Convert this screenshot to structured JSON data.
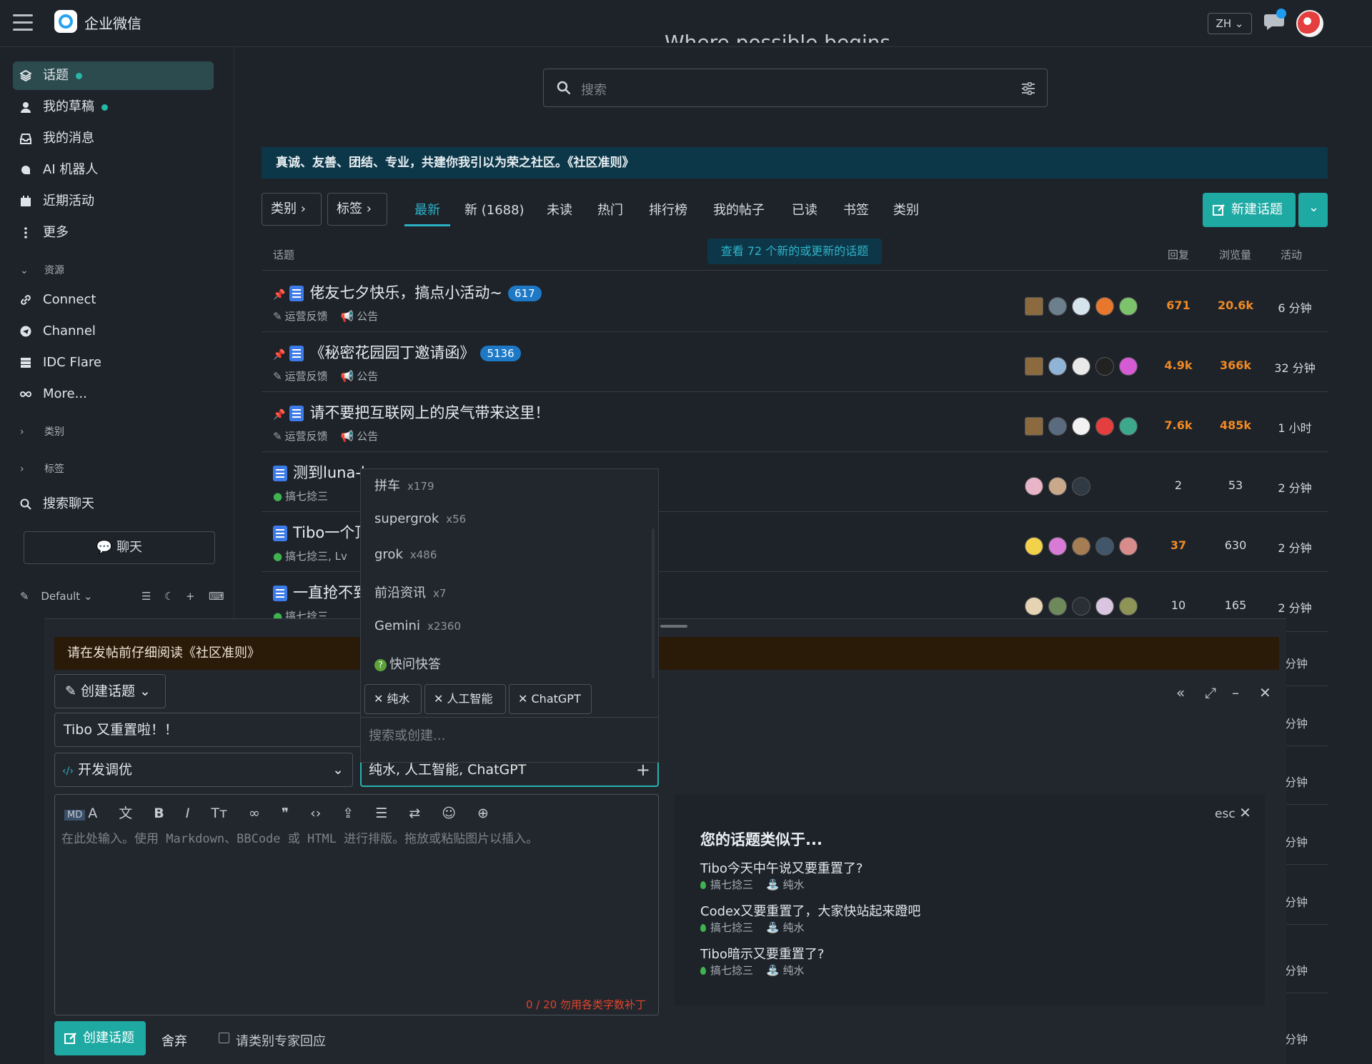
{
  "header": {
    "app_title": "企业微信",
    "lang": "ZH"
  },
  "sidebar": {
    "items": [
      {
        "label": "话题"
      },
      {
        "label": "我的草稿"
      },
      {
        "label": "我的消息"
      },
      {
        "label": "AI 机器人"
      },
      {
        "label": "近期活动"
      },
      {
        "label": "更多"
      }
    ],
    "resources_label": "资源",
    "resources": [
      {
        "label": "Connect"
      },
      {
        "label": "Channel"
      },
      {
        "label": "IDC Flare"
      },
      {
        "label": "More..."
      }
    ],
    "categories_label": "类别",
    "tags_label": "标签",
    "search_chat": "搜索聊天",
    "chat_button": "聊天",
    "theme_label": "Default"
  },
  "main": {
    "partial_heading": "Where possible begins",
    "search_placeholder": "搜索",
    "banner": "真诚、友善、团结、专业，共建你我引以为荣之社区。《社区准则》",
    "filters": {
      "category": "类别",
      "tag": "标签"
    },
    "tabs": [
      {
        "label": "最新"
      },
      {
        "label": "新 (1688)"
      },
      {
        "label": "未读"
      },
      {
        "label": "热门"
      },
      {
        "label": "排行榜"
      },
      {
        "label": "我的帖子"
      },
      {
        "label": "已读"
      },
      {
        "label": "书签"
      },
      {
        "label": "类别"
      }
    ],
    "new_topic": "新建话题",
    "columns": {
      "topic": "话题",
      "replies": "回复",
      "views": "浏览量",
      "activity": "活动"
    },
    "new_topics_notice": "查看 72 个新的或更新的话题",
    "topics": [
      {
        "title": "佬友七夕快乐，搞点小活动~",
        "badge": "617",
        "category": "运营反馈",
        "tag": "公告",
        "replies": "671",
        "views": "20.6k",
        "activity": "6 分钟"
      },
      {
        "title": "《秘密花园园丁邀请函》",
        "badge": "5136",
        "category": "运营反馈",
        "tag": "公告",
        "replies": "4.9k",
        "views": "366k",
        "activity": "32 分钟"
      },
      {
        "title": "请不要把互联网上的戾气带来这里！",
        "badge": "",
        "category": "运营反馈",
        "tag": "公告",
        "replies": "7.6k",
        "views": "485k",
        "activity": "1 小时"
      },
      {
        "title": "测到luna-l",
        "badge": "",
        "category": "搞七捻三",
        "tag": "",
        "replies": "2",
        "views": "53",
        "activity": "2 分钟"
      },
      {
        "title": "Tibo一个顶",
        "badge": "",
        "category": "搞七捻三, Lv",
        "tag": "",
        "replies": "37",
        "views": "630",
        "activity": "2 分钟"
      },
      {
        "title": "一直抢不到",
        "badge": "",
        "category": "搞七捻三",
        "tag": "",
        "replies": "10",
        "views": "165",
        "activity": "2 分钟"
      }
    ],
    "right_activity": [
      "分钟",
      "分钟",
      "分钟",
      "分钟",
      "分钟",
      "分钟",
      "分钟"
    ]
  },
  "composer": {
    "notice": "请在发帖前仔细阅读《社区准则》",
    "action": "创建话题",
    "title_value": "Tibo 又重置啦！！",
    "category_value": "开发调优",
    "tags_value": "纯水, 人工智能, ChatGPT",
    "editor_placeholder": "在此处输入。使用 Markdown、BBCode 或 HTML 进行排版。拖放或粘贴图片以插入。",
    "count_hint": "0 / 20 勿用各类字数补丁",
    "create_button": "创建话题",
    "discard": "舍弃",
    "expert_checkbox": "请类别专家回应"
  },
  "tag_dropdown": {
    "options": [
      {
        "name": "拼车",
        "count": "x179"
      },
      {
        "name": "supergrok",
        "count": "x56"
      },
      {
        "name": "grok",
        "count": "x486"
      },
      {
        "name": "前沿资讯",
        "count": "x7"
      },
      {
        "name": "Gemini",
        "count": "x2360"
      },
      {
        "name": "快问快答",
        "count": ""
      }
    ],
    "selected": [
      "纯水",
      "人工智能",
      "ChatGPT"
    ],
    "search_placeholder": "搜索或创建..."
  },
  "similar": {
    "esc": "esc",
    "title": "您的话题类似于...",
    "items": [
      {
        "title": "Tibo今天中午说又要重置了?",
        "category": "搞七捻三",
        "tag": "纯水"
      },
      {
        "title": "Codex又要重置了，大家快站起来蹬吧",
        "category": "搞七捻三",
        "tag": "纯水"
      },
      {
        "title": "Tibo暗示又要重置了?",
        "category": "搞七捻三",
        "tag": "纯水"
      }
    ]
  }
}
